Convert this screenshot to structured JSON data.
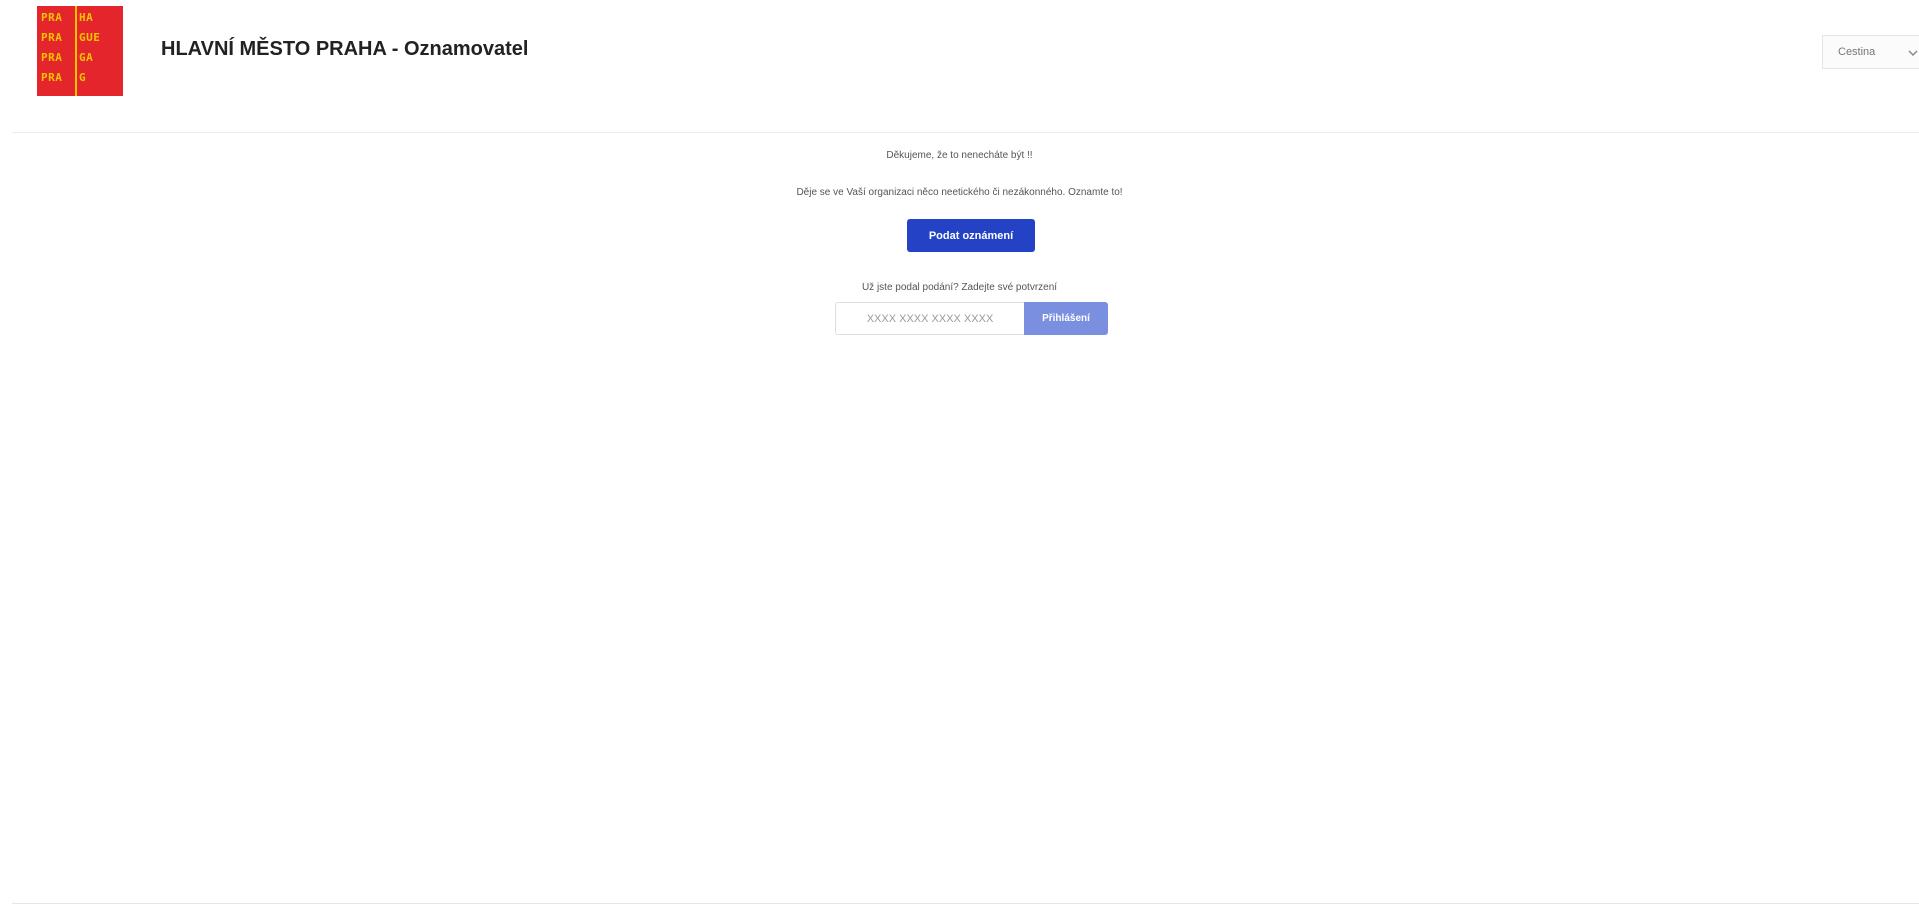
{
  "header": {
    "logo": {
      "rows": [
        {
          "left": "PRA",
          "right": "HA"
        },
        {
          "left": "PRA",
          "right": "GUE"
        },
        {
          "left": "PRA",
          "right": "GA"
        },
        {
          "left": "PRA",
          "right": "G"
        }
      ],
      "background_color": "#e4252b",
      "text_color": "#f4c400"
    },
    "title": "HLAVNÍ MĚSTO PRAHA - Oznamovatel",
    "language": {
      "selected": "Cestina",
      "icon": "chevron-down-icon"
    }
  },
  "main": {
    "thanks_text": "Děkujeme, že to nenecháte být !!",
    "prompt_text": "Děje se ve Vaší organizaci něco neetického či nezákonného. Oznamte to!",
    "report_button_label": "Podat oznámení",
    "already_submitted_text": "Už jste podal podání? Zadejte své potvrzení",
    "confirmation_placeholder": "XXXX XXXX XXXX XXXX",
    "confirmation_value": "",
    "login_button_label": "Přihlášení"
  },
  "colors": {
    "primary": "#2442c6",
    "primary_light": "#7b8fe0",
    "divider": "#ececec"
  }
}
